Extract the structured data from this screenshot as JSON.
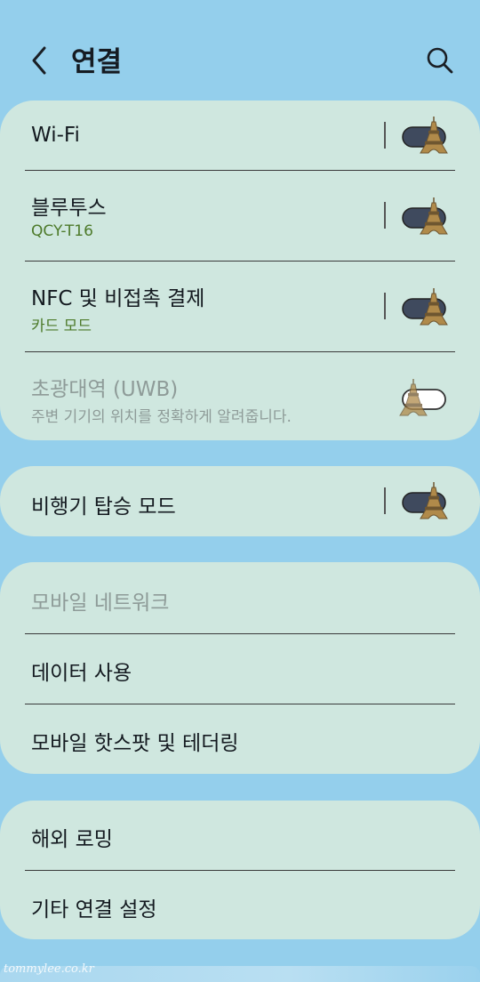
{
  "header": {
    "title": "연결",
    "back_icon": "chevron-left-icon",
    "search_icon": "search-icon"
  },
  "groups": [
    {
      "items": [
        {
          "label": "Wi-Fi",
          "sub": "",
          "toggle_on": true
        },
        {
          "label": "블루투스",
          "sub": "QCY-T16",
          "toggle_on": true
        },
        {
          "label": "NFC 및 비접촉 결제",
          "sub": "카드 모드",
          "toggle_on": true
        },
        {
          "label": "초광대역 (UWB)",
          "sub": "주변 기기의 위치를 정확하게 알려줍니다.",
          "toggle_on": false,
          "disabled": true
        }
      ]
    },
    {
      "items": [
        {
          "label": "비행기 탑승 모드",
          "toggle_on": true
        }
      ]
    },
    {
      "items": [
        {
          "label": "모바일 네트워크",
          "disabled": true
        },
        {
          "label": "데이터 사용"
        },
        {
          "label": "모바일 핫스팟 및 테더링"
        }
      ]
    },
    {
      "items": [
        {
          "label": "해외 로밍"
        },
        {
          "label": "기타 연결 설정"
        }
      ]
    }
  ],
  "watermark": "tommylee.co.kr",
  "colors": {
    "background": "#94cfec",
    "card": "#cfe7df",
    "accent_sub": "#4d7a2a",
    "toggle_track_on": "#3f4a5e",
    "disabled_text": "#8e9b98"
  },
  "toggle_thumb_icon": "eiffel-tower-icon"
}
